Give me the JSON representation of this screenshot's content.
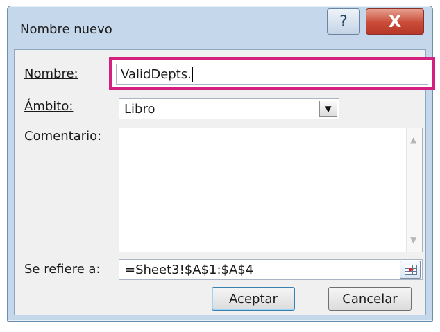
{
  "dialog": {
    "title": "Nombre nuevo",
    "help_glyph": "?",
    "close_glyph": "X"
  },
  "fields": {
    "name_label": "Nombre:",
    "name_value": "ValidDepts.",
    "scope_label": "Ámbito:",
    "scope_value": "Libro",
    "comment_label": "Comentario:",
    "comment_value": "",
    "refers_label": "Se refiere a:",
    "refers_value": "=Sheet3!$A$1:$A$4"
  },
  "buttons": {
    "ok_label": "Aceptar",
    "cancel_label": "Cancelar"
  },
  "colors": {
    "highlight": "#d4217f",
    "title_bar": "#c5d7ea",
    "close_button": "#c94b38"
  }
}
